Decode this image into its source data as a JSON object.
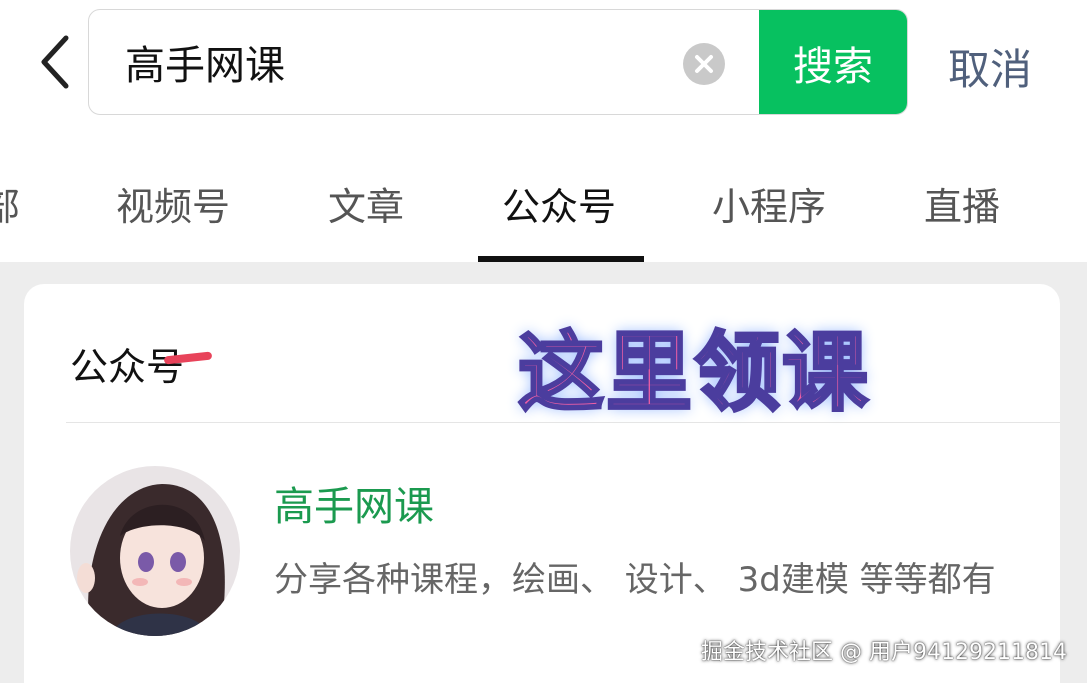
{
  "search": {
    "value": "高手网课",
    "button_label": "搜索",
    "cancel_label": "取消"
  },
  "tabs": [
    {
      "label": "部"
    },
    {
      "label": "视频号"
    },
    {
      "label": "文章"
    },
    {
      "label": "公众号"
    },
    {
      "label": "小程序"
    },
    {
      "label": "直播"
    }
  ],
  "result": {
    "section_title": "公众号",
    "promo_text": "这里领课",
    "account_name": "高手网课",
    "account_desc": "分享各种课程，绘画、 设计、 3d建模 等等都有"
  },
  "watermark": "掘金技术社区 @ 用户94129211814",
  "colors": {
    "accent_green": "#07c160",
    "name_green": "#1b9a4f",
    "cancel_blue": "#50607c",
    "promo_pink": "#f05fa6",
    "mark_red": "#e8435a"
  },
  "icons": {
    "back": "chevron-left",
    "clear": "circle-x"
  }
}
